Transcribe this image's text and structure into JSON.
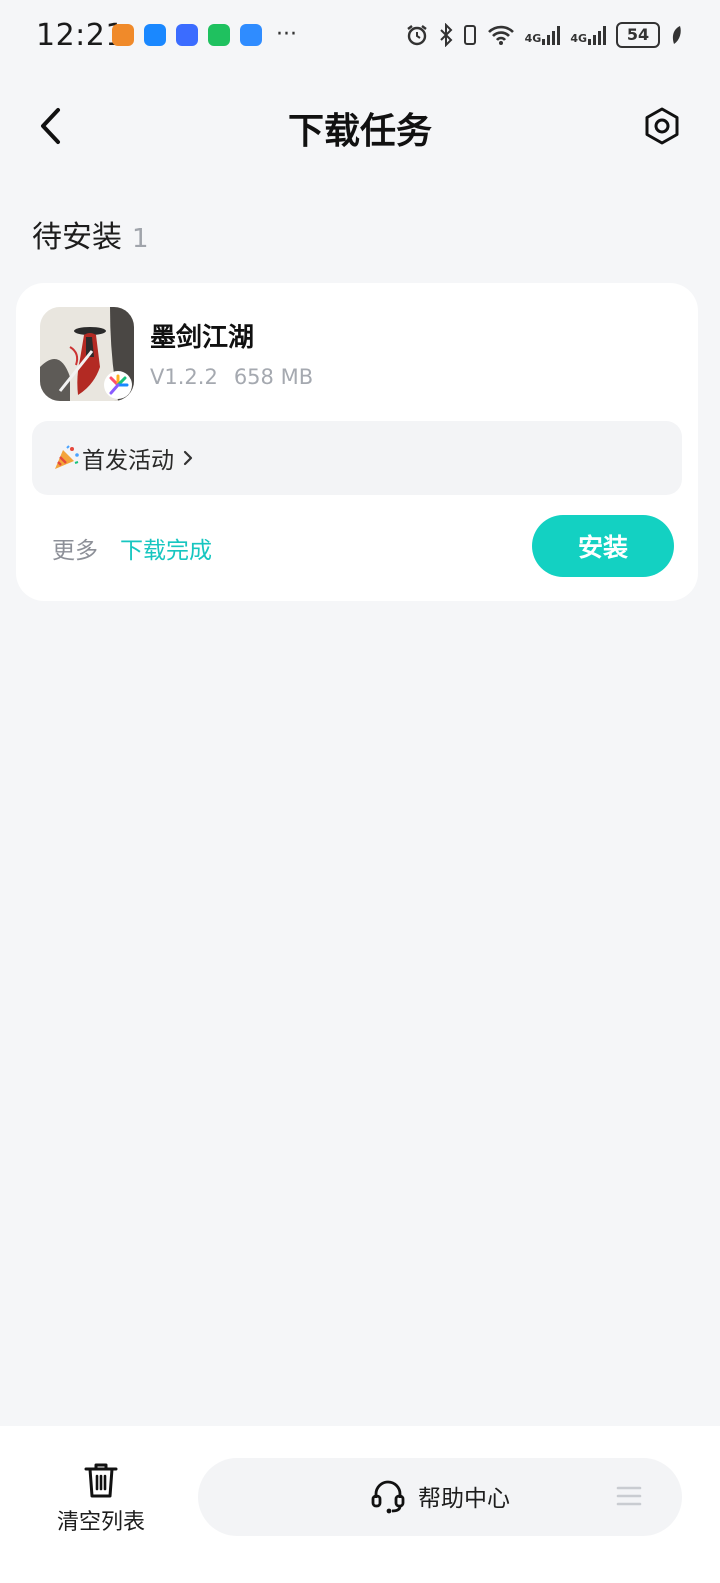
{
  "status_bar": {
    "time": "12:21",
    "notification_icons": [
      "health-app-icon",
      "message-icon",
      "transfer-icon",
      "wechat-icon",
      "weather-icon"
    ],
    "more": "···",
    "signal_1": "4G",
    "signal_2": "4G",
    "battery": "54"
  },
  "header": {
    "title": "下载任务",
    "back_icon": "back-arrow-icon",
    "settings_icon": "settings-hex-icon"
  },
  "section": {
    "title": "待安装",
    "count": "1"
  },
  "task": {
    "app_name": "墨剑江湖",
    "version": "V1.2.2",
    "size": "658 MB",
    "promo_label": "首发活动",
    "more_label": "更多",
    "status_label": "下载完成",
    "install_label": "安装"
  },
  "bottom_bar": {
    "clear_label": "清空列表",
    "help_label": "帮助中心"
  },
  "colors": {
    "accent": "#13d1c2",
    "status_text": "#17c6c0",
    "background": "#f5f6f8"
  }
}
